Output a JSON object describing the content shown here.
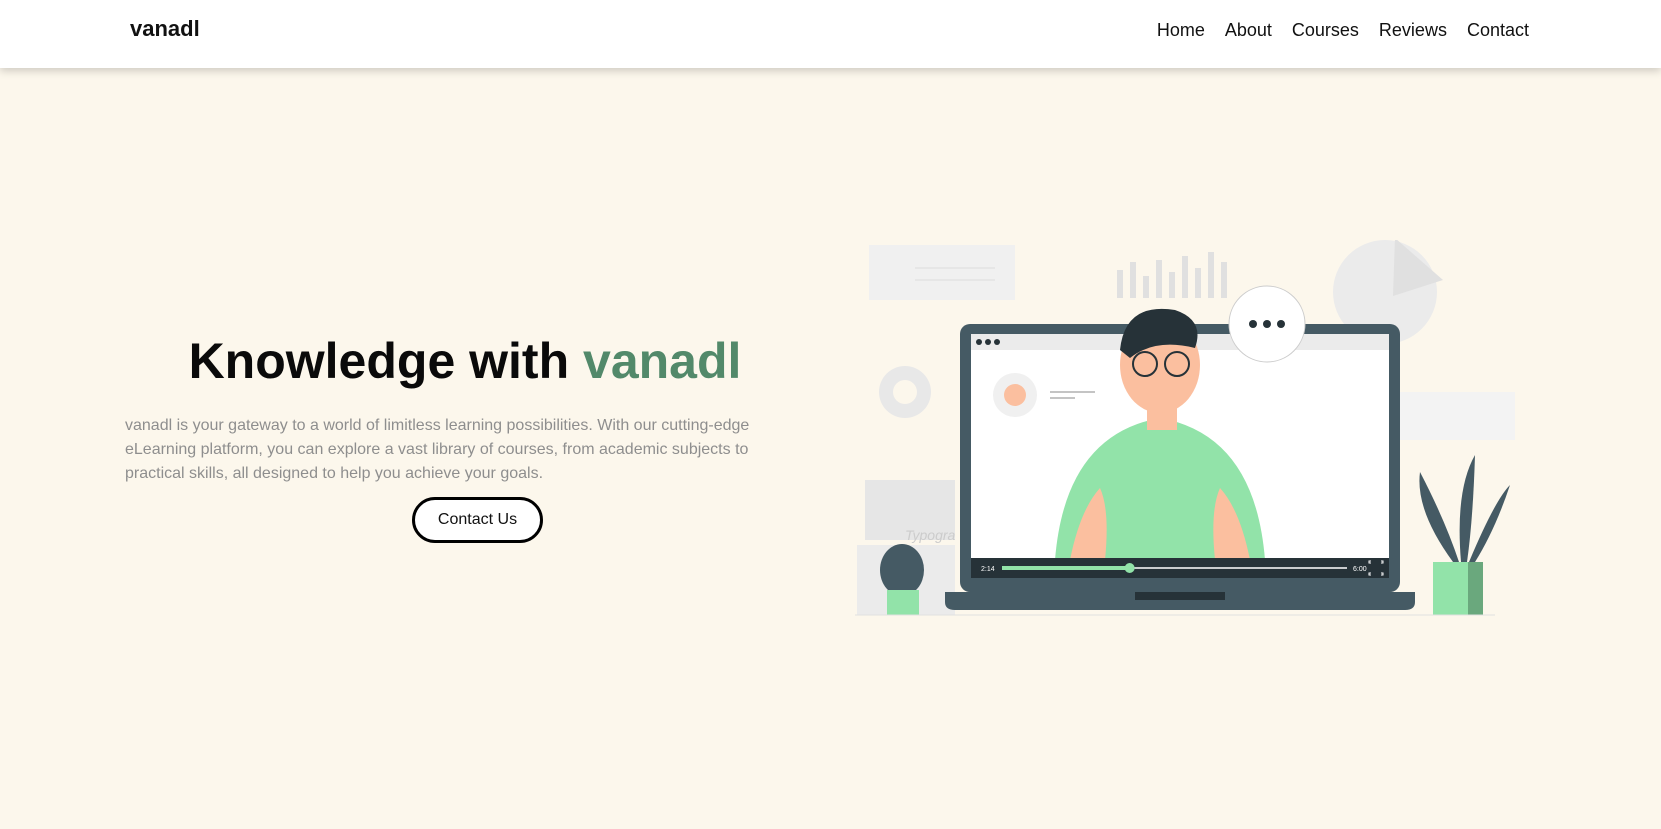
{
  "nav": {
    "logo": "vanadl",
    "links": [
      "Home",
      "About",
      "Courses",
      "Reviews",
      "Contact"
    ]
  },
  "hero": {
    "title_prefix": "Knowledge with ",
    "title_accent": "vanadl",
    "description": "vanadl is your gateway to a world of limitless learning possibilities. With our cutting-edge eLearning platform, you can explore a vast library of courses, from academic subjects to practical skills, all designed to help you achieve your goals.",
    "cta": "Contact Us"
  },
  "illustration": {
    "video_current": "2:14",
    "video_total": "6:00",
    "progress_fraction": 0.37,
    "book_text": "Typogra"
  },
  "colors": {
    "accent": "#52896a",
    "background": "#fcf7ec",
    "laptop": "#455a64",
    "shirt": "#92e3a9"
  }
}
